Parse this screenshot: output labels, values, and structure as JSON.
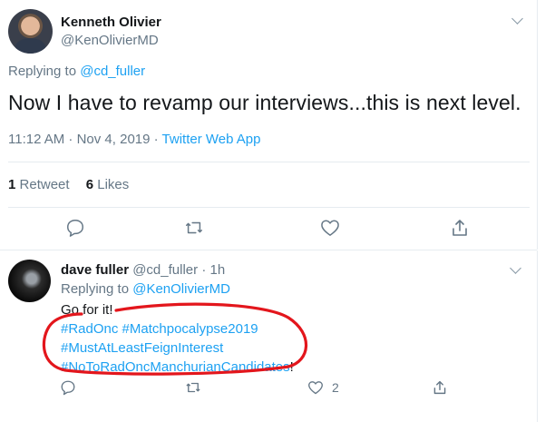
{
  "main_tweet": {
    "author_name": "Kenneth Olivier",
    "author_handle": "@KenOlivierMD",
    "replying_prefix": "Replying to ",
    "replying_to": "@cd_fuller",
    "text": "Now I have to revamp our interviews...this is next level.",
    "timestamp": "11:12 AM · Nov 4, 2019 · ",
    "source": "Twitter Web App",
    "retweets": {
      "count": "1",
      "label": "Retweet"
    },
    "likes": {
      "count": "6",
      "label": "Likes"
    }
  },
  "reply_tweet": {
    "author_name": "dave fuller",
    "author_handle": "@cd_fuller",
    "time": "· 1h",
    "replying_prefix": "Replying to ",
    "replying_to": "@KenOlivierMD",
    "line1": "Go for it!",
    "hashtags_line1": "#RadOnc #Matchpocalypse2019",
    "hashtags_line2": "#MustAtLeastFeignInterest",
    "hashtags_line3": "#NoToRadOncManchurianCandidates",
    "hashtags_line3_suffix": "!",
    "like_count": "2"
  },
  "colors": {
    "link": "#1da1f2",
    "muted": "#657786",
    "annotation": "#e3161c"
  },
  "icons": [
    "reply-icon",
    "retweet-icon",
    "like-icon",
    "share-icon",
    "chevron-down-icon"
  ]
}
